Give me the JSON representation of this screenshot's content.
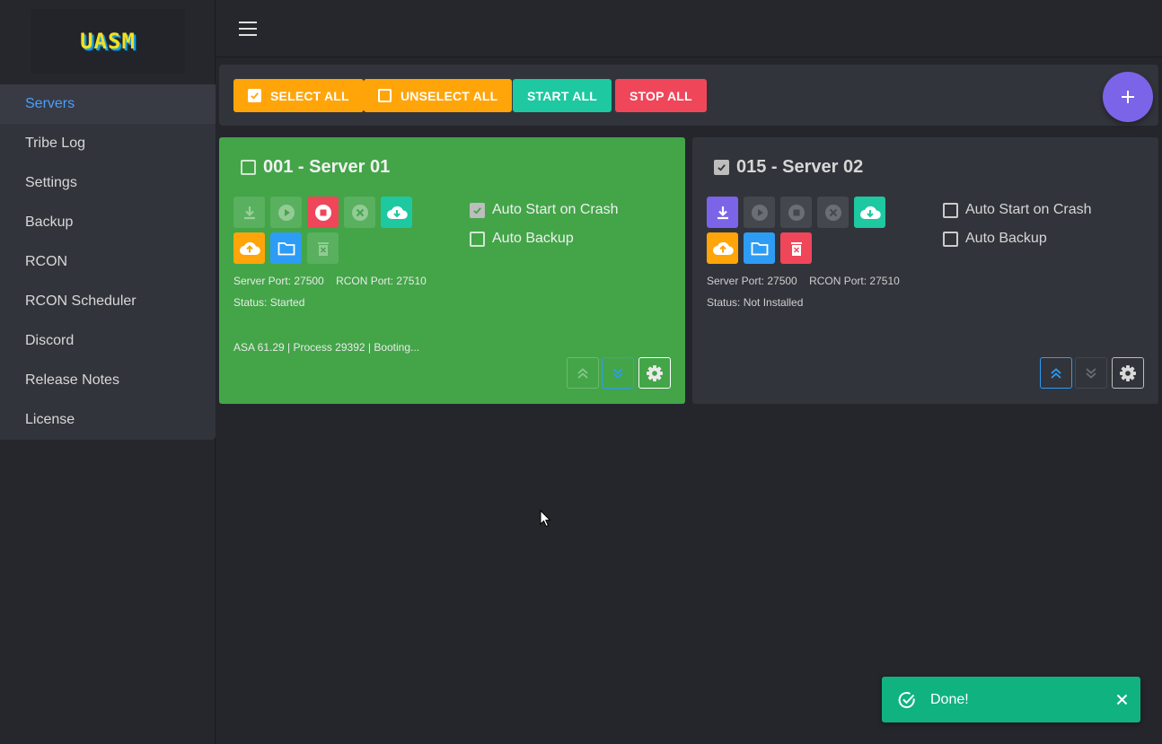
{
  "app": {
    "logo": "UASM"
  },
  "sidebar": {
    "items": [
      {
        "label": "Servers"
      },
      {
        "label": "Tribe Log"
      },
      {
        "label": "Settings"
      },
      {
        "label": "Backup"
      },
      {
        "label": "RCON"
      },
      {
        "label": "RCON Scheduler"
      },
      {
        "label": "Discord"
      },
      {
        "label": "Release Notes"
      },
      {
        "label": "License"
      }
    ],
    "active": "Servers"
  },
  "toolbar": {
    "select_all": "SELECT ALL",
    "unselect_all": "UNSELECT ALL",
    "start_all": "START ALL",
    "stop_all": "STOP ALL"
  },
  "servers": [
    {
      "title": "001 - Server 01",
      "selected": false,
      "server_port": "Server Port: 27500",
      "rcon_port": "RCON Port: 27510",
      "status": "Status: Started",
      "process_info": "ASA 61.29 | Process 29392 | Booting...",
      "auto_start_label": "Auto Start on Crash",
      "auto_start": true,
      "auto_backup_label": "Auto Backup",
      "auto_backup": false
    },
    {
      "title": "015 - Server 02",
      "selected": true,
      "server_port": "Server Port: 27500",
      "rcon_port": "RCON Port: 27510",
      "status": "Status: Not Installed",
      "auto_start_label": "Auto Start on Crash",
      "auto_start": false,
      "auto_backup_label": "Auto Backup",
      "auto_backup": false
    }
  ],
  "toast": {
    "message": "Done!"
  },
  "colors": {
    "accent": "#4a9eff",
    "running_card": "#43a548",
    "yellow": "#ffa50a",
    "teal": "#1ec8a0",
    "red": "#f0465a",
    "blue": "#2d9cf5",
    "purple": "#7b64e8",
    "toast": "#10b380"
  }
}
